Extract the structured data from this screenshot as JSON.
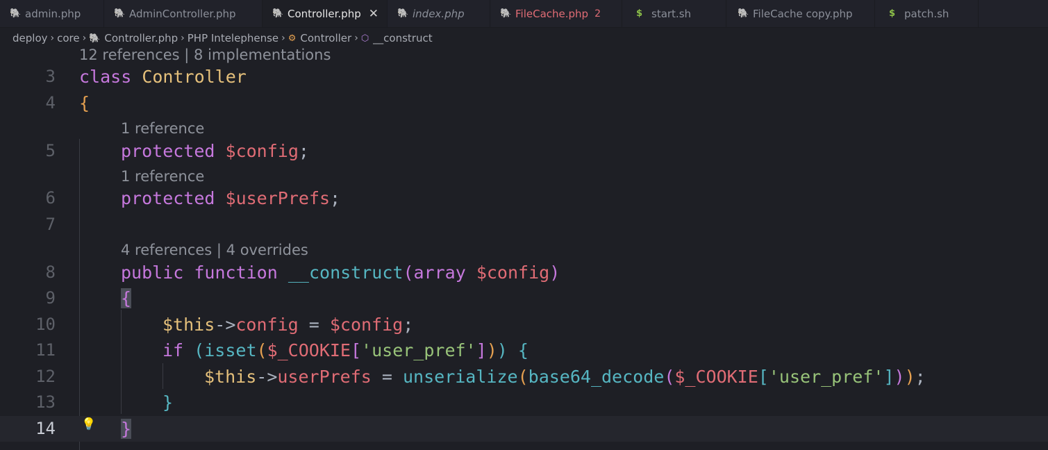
{
  "tabs": [
    {
      "label": "admin.php",
      "icon": "php-elephant-icon"
    },
    {
      "label": "AdminController.php",
      "icon": "php-elephant-icon"
    },
    {
      "label": "Controller.php",
      "icon": "php-elephant-icon",
      "active": true,
      "close": "✕"
    },
    {
      "label": "index.php",
      "icon": "php-elephant-icon",
      "italic": true
    },
    {
      "label": "FileCache.php",
      "icon": "php-elephant-icon",
      "badge": "2"
    },
    {
      "label": "start.sh",
      "icon": "dollar-shell-icon"
    },
    {
      "label": "FileCache copy.php",
      "icon": "php-elephant-icon"
    },
    {
      "label": "patch.sh",
      "icon": "dollar-shell-icon"
    }
  ],
  "breadcrumb": {
    "items": [
      "deploy",
      "core",
      "Controller.php",
      "PHP Intelephense",
      "Controller",
      "__construct"
    ]
  },
  "lenses": {
    "class": "12 references | 8 implementations",
    "config": "1 reference",
    "userPrefs": "1 reference",
    "construct": "4 references | 4 overrides"
  },
  "code": {
    "line_numbers": [
      "3",
      "4",
      "5",
      "6",
      "7",
      "8",
      "9",
      "10",
      "11",
      "12",
      "13",
      "14"
    ],
    "kw_class": "class",
    "class_name": "Controller",
    "brace_open": "{",
    "brace_close": "}",
    "kw_protected": "protected",
    "var_config": "$config",
    "var_userPrefs": "$userPrefs",
    "semicolon": ";",
    "kw_public": "public",
    "kw_function": "function",
    "fn_construct": "__construct",
    "paren_open": "(",
    "paren_close": ")",
    "kw_array": "array",
    "this": "$this",
    "arrow": "->",
    "prop_config": "config",
    "prop_userPrefs": "userPrefs",
    "assign": " = ",
    "kw_if": "if",
    "fn_isset": "isset",
    "var_cookie": "$_COOKIE",
    "bracket_open": "[",
    "bracket_close": "]",
    "str_user_pref": "'user_pref'",
    "fn_unserialize": "unserialize",
    "fn_base64_decode": "base64_decode"
  },
  "colors": {
    "background": "#1e1f25",
    "keyword": "#c678dd",
    "class": "#e5c07b",
    "variable": "#e06c75",
    "function": "#56b6c2",
    "string": "#98c379"
  }
}
